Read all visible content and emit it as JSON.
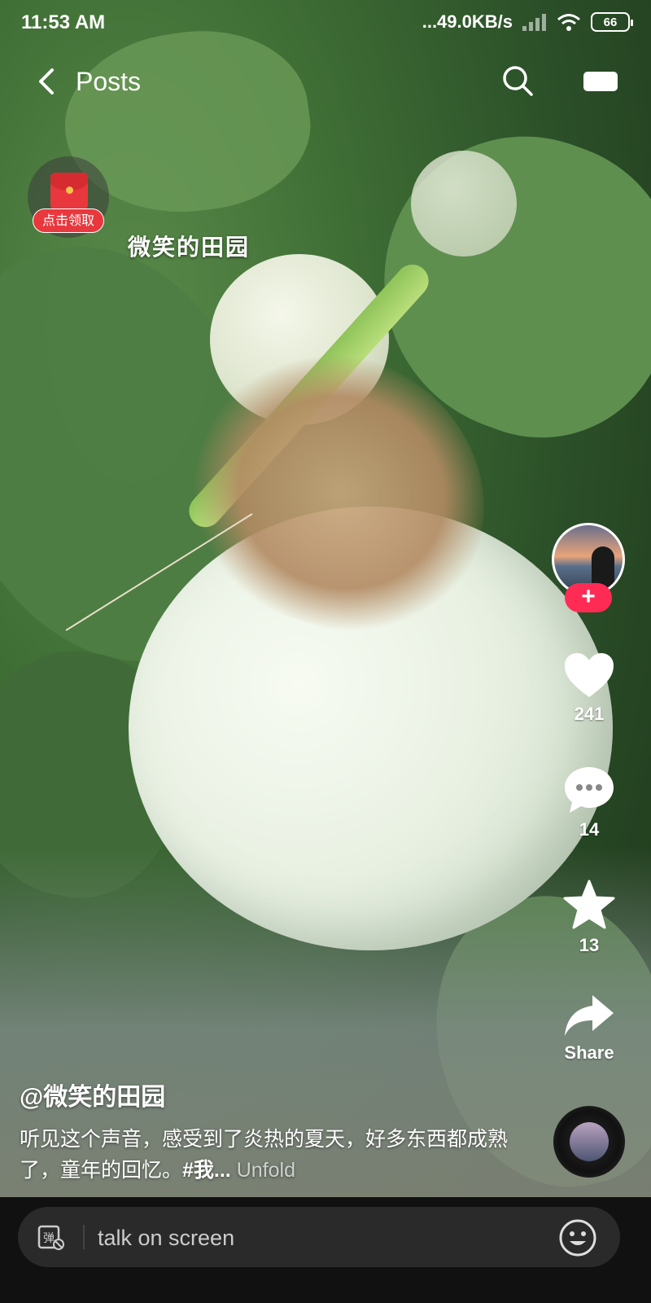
{
  "status_bar": {
    "time": "11:53 AM",
    "network_speed": "...49.0KB/s",
    "battery": "66",
    "icons": [
      "signal-icon",
      "wifi-icon",
      "battery-icon"
    ]
  },
  "header": {
    "title": "Posts",
    "icons": [
      "back-icon",
      "search-icon",
      "camera-icon"
    ]
  },
  "red_packet": {
    "label": "点击领取"
  },
  "video": {
    "watermark": "微笑的田园"
  },
  "actions": {
    "likes": "241",
    "comments": "14",
    "favorites": "13",
    "share_label": "Share",
    "follow_symbol": "+"
  },
  "caption": {
    "author": "@微笑的田园",
    "text": "听见这个声音，感受到了炎热的夏天，好多东西都成熟了，童年的回忆。",
    "hashtag": "#我...",
    "unfold": "Unfold"
  },
  "comment_bar": {
    "placeholder": "talk on screen",
    "icons": [
      "danmaku-icon",
      "emoji-icon"
    ]
  },
  "colors": {
    "accent": "#fe2c55",
    "red_packet": "#e8383d",
    "bottom_bar": "#111111"
  }
}
